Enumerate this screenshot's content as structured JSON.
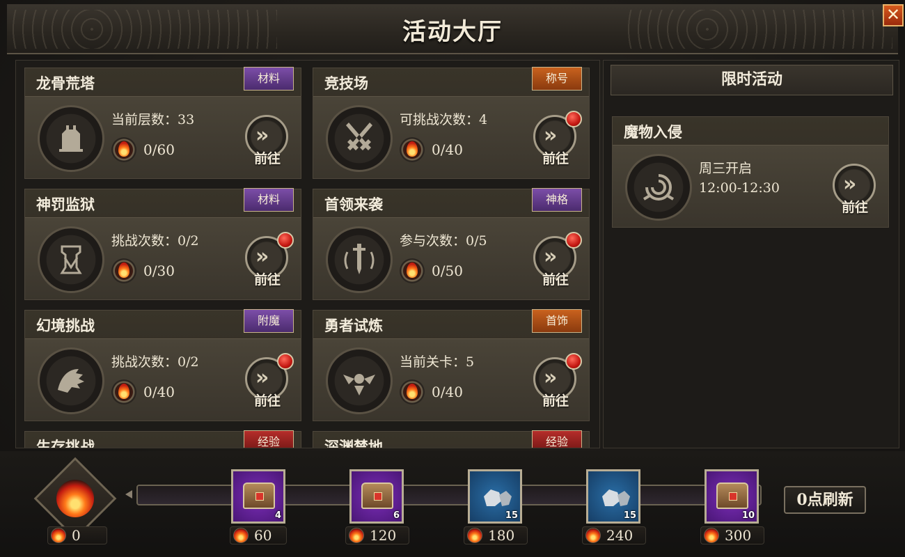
{
  "window": {
    "title": "活动大厅",
    "close_label": "✕"
  },
  "activities": [
    {
      "name": "龙骨荒塔",
      "tag": "材料",
      "tag_color": "purple",
      "info": "当前层数：33",
      "fire": "0/60",
      "go": "前往",
      "icon": "dragon-tower-icon",
      "red_dot": false
    },
    {
      "name": "竞技场",
      "tag": "称号",
      "tag_color": "orange",
      "info": "可挑战次数：4",
      "fire": "0/40",
      "go": "前往",
      "icon": "crossed-swords-icon",
      "red_dot": true
    },
    {
      "name": "神罚监狱",
      "tag": "材料",
      "tag_color": "purple",
      "info": "挑战次数：0/2",
      "fire": "0/30",
      "go": "前往",
      "icon": "prison-crest-icon",
      "red_dot": true
    },
    {
      "name": "首领来袭",
      "tag": "神格",
      "tag_color": "purple",
      "info": "参与次数：0/5",
      "fire": "0/50",
      "go": "前往",
      "icon": "boss-sword-icon",
      "red_dot": true
    },
    {
      "name": "幻境挑战",
      "tag": "附魔",
      "tag_color": "purple",
      "info": "挑战次数：0/2",
      "fire": "0/40",
      "go": "前往",
      "icon": "wolf-head-icon",
      "red_dot": true
    },
    {
      "name": "勇者试炼",
      "tag": "首饰",
      "tag_color": "orange",
      "info": "当前关卡：5",
      "fire": "0/40",
      "go": "前往",
      "icon": "hero-wings-icon",
      "red_dot": true
    },
    {
      "name": "生存挑战",
      "tag": "经验",
      "tag_color": "red"
    },
    {
      "name": "深渊禁地",
      "tag": "经验",
      "tag_color": "red"
    }
  ],
  "limited": {
    "header": "限时活动",
    "event": {
      "name": "魔物入侵",
      "schedule": "周三开启",
      "time": "12:00-12:30",
      "go": "前往",
      "icon": "spiral-crest-icon"
    }
  },
  "progress": {
    "current": "0",
    "value": 0,
    "max": 300,
    "rewards": [
      {
        "threshold": "60",
        "count": "4",
        "type": "chest",
        "rarity": "purple"
      },
      {
        "threshold": "120",
        "count": "6",
        "type": "chest",
        "rarity": "purple"
      },
      {
        "threshold": "180",
        "count": "15",
        "type": "ore",
        "rarity": "blue"
      },
      {
        "threshold": "240",
        "count": "15",
        "type": "ore",
        "rarity": "blue"
      },
      {
        "threshold": "300",
        "count": "10",
        "type": "chest",
        "rarity": "purple"
      }
    ],
    "refresh_label": "0点刷新"
  },
  "colors": {
    "accent_fire": "#ff7a1a",
    "tag_purple": "#7c4ea8",
    "tag_orange": "#c9621e",
    "tag_red": "#b52d2a"
  }
}
